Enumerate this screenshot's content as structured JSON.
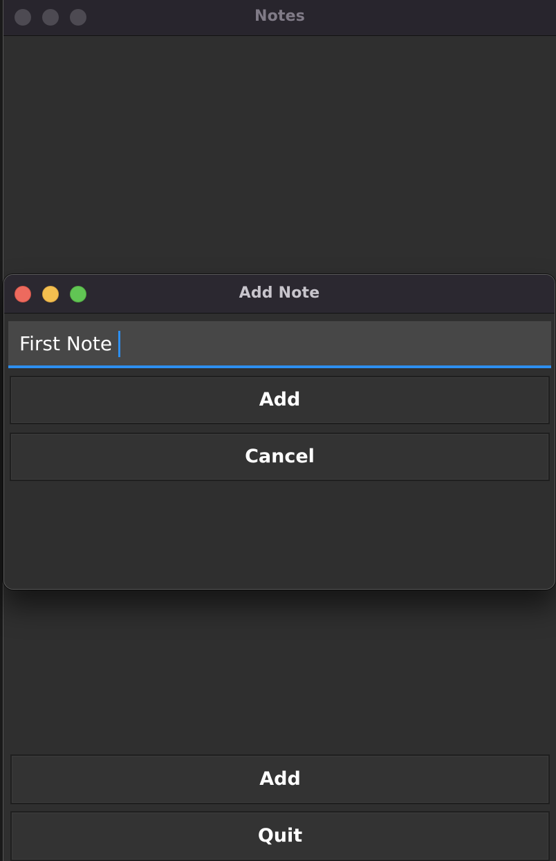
{
  "main_window": {
    "title": "Notes",
    "buttons": {
      "add_label": "Add",
      "quit_label": "Quit"
    }
  },
  "dialog": {
    "title": "Add Note",
    "input": {
      "value": "First Note",
      "placeholder": ""
    },
    "buttons": {
      "add_label": "Add",
      "cancel_label": "Cancel"
    }
  },
  "colors": {
    "background": "#2f2f2f",
    "titlebar": "#2a2530",
    "accent_focus": "#2d8ff0",
    "close": "#ed6a5e",
    "minimize": "#f4bf4f",
    "zoom": "#61c554",
    "inactive_traffic": "#4d4a52"
  },
  "icons": {
    "close": "close-icon",
    "minimize": "minimize-icon",
    "zoom": "zoom-icon"
  }
}
